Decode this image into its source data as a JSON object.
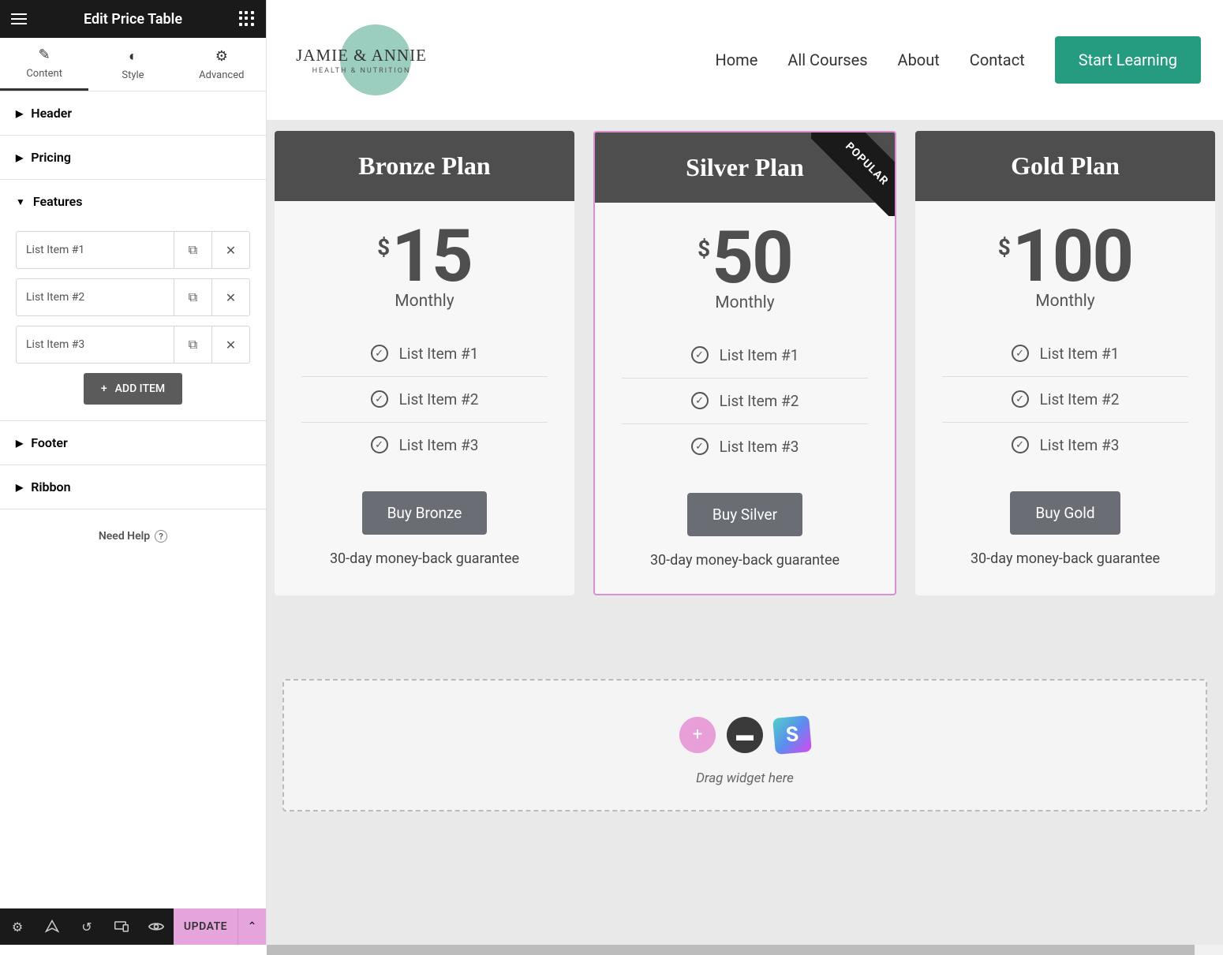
{
  "sidebar": {
    "title": "Edit Price Table",
    "tabs": {
      "content": "Content",
      "style": "Style",
      "advanced": "Advanced"
    },
    "sections": {
      "header": "Header",
      "pricing": "Pricing",
      "features": "Features",
      "footer": "Footer",
      "ribbon": "Ribbon"
    },
    "featureItems": [
      {
        "label": "List Item #1"
      },
      {
        "label": "List Item #2"
      },
      {
        "label": "List Item #3"
      }
    ],
    "addItem": "ADD ITEM",
    "needHelp": "Need Help",
    "update": "UPDATE"
  },
  "site": {
    "logoMain": "JAMIE & ANNIE",
    "logoSub": "HEALTH & NUTRITION",
    "nav": {
      "home": "Home",
      "courses": "All Courses",
      "about": "About",
      "contact": "Contact"
    },
    "cta": "Start Learning"
  },
  "plans": [
    {
      "title": "Bronze Plan",
      "currency": "$",
      "amount": "15",
      "period": "Monthly",
      "features": [
        "List Item #1",
        "List Item #2",
        "List Item #3"
      ],
      "button": "Buy Bronze",
      "guarantee": "30-day money-back guarantee",
      "ribbon": null,
      "selected": false
    },
    {
      "title": "Silver Plan",
      "currency": "$",
      "amount": "50",
      "period": "Monthly",
      "features": [
        "List Item #1",
        "List Item #2",
        "List Item #3"
      ],
      "button": "Buy Silver",
      "guarantee": "30-day money-back guarantee",
      "ribbon": "POPULAR",
      "selected": true
    },
    {
      "title": "Gold Plan",
      "currency": "$",
      "amount": "100",
      "period": "Monthly",
      "features": [
        "List Item #1",
        "List Item #2",
        "List Item #3"
      ],
      "button": "Buy Gold",
      "guarantee": "30-day money-back guarantee",
      "ribbon": null,
      "selected": false
    }
  ],
  "dropZone": {
    "hint": "Drag widget here"
  }
}
